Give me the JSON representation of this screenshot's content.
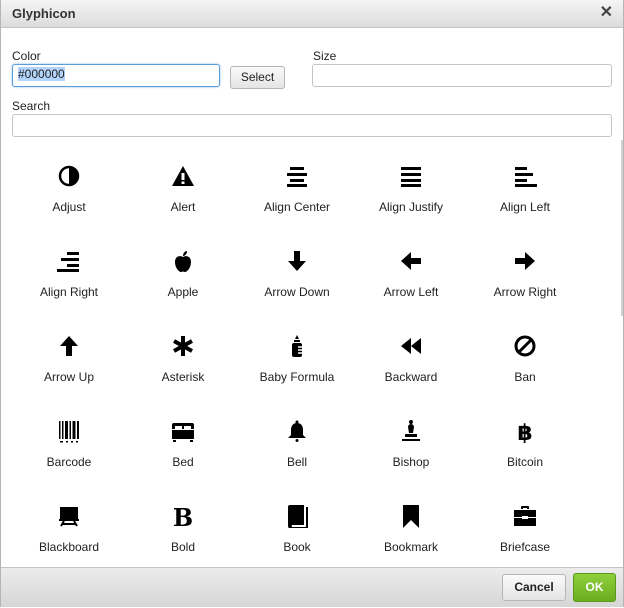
{
  "dialog": {
    "title": "Glyphicon",
    "close_icon": "close-icon"
  },
  "form": {
    "color_label": "Color",
    "color_value": "#000000",
    "select_button": "Select",
    "size_label": "Size",
    "size_value": "",
    "search_label": "Search",
    "search_value": ""
  },
  "glyphs": [
    {
      "label": "Adjust",
      "icon": "adjust-icon"
    },
    {
      "label": "Alert",
      "icon": "alert-icon"
    },
    {
      "label": "Align Center",
      "icon": "align-center-icon"
    },
    {
      "label": "Align Justify",
      "icon": "align-justify-icon"
    },
    {
      "label": "Align Left",
      "icon": "align-left-icon"
    },
    {
      "label": "Align Right",
      "icon": "align-right-icon"
    },
    {
      "label": "Apple",
      "icon": "apple-icon"
    },
    {
      "label": "Arrow Down",
      "icon": "arrow-down-icon"
    },
    {
      "label": "Arrow Left",
      "icon": "arrow-left-icon"
    },
    {
      "label": "Arrow Right",
      "icon": "arrow-right-icon"
    },
    {
      "label": "Arrow Up",
      "icon": "arrow-up-icon"
    },
    {
      "label": "Asterisk",
      "icon": "asterisk-icon"
    },
    {
      "label": "Baby Formula",
      "icon": "baby-formula-icon"
    },
    {
      "label": "Backward",
      "icon": "backward-icon"
    },
    {
      "label": "Ban",
      "icon": "ban-icon"
    },
    {
      "label": "Barcode",
      "icon": "barcode-icon"
    },
    {
      "label": "Bed",
      "icon": "bed-icon"
    },
    {
      "label": "Bell",
      "icon": "bell-icon"
    },
    {
      "label": "Bishop",
      "icon": "bishop-icon"
    },
    {
      "label": "Bitcoin",
      "icon": "bitcoin-icon"
    },
    {
      "label": "Blackboard",
      "icon": "blackboard-icon"
    },
    {
      "label": "Bold",
      "icon": "bold-icon"
    },
    {
      "label": "Book",
      "icon": "book-icon"
    },
    {
      "label": "Bookmark",
      "icon": "bookmark-icon"
    },
    {
      "label": "Briefcase",
      "icon": "briefcase-icon"
    }
  ],
  "footer": {
    "cancel_button": "Cancel",
    "ok_button": "OK"
  },
  "colors": {
    "ok_green": "#76b82a",
    "focus_blue": "#5b9dd9",
    "selection": "#b3d4fc"
  }
}
